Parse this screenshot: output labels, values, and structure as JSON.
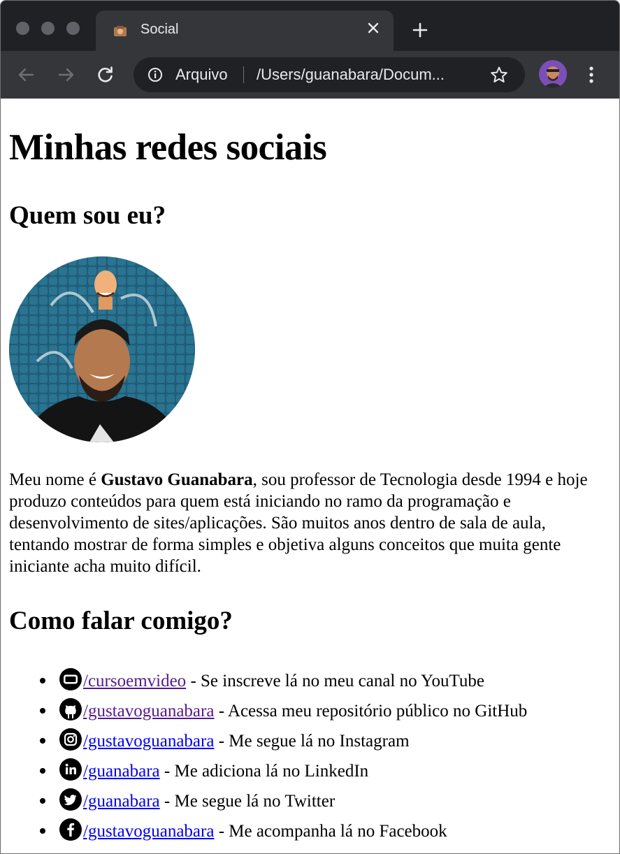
{
  "browser": {
    "tab_title": "Social",
    "site_label": "Arquivo",
    "url": "/Users/guanabara/Docum..."
  },
  "page": {
    "heading": "Minhas redes sociais",
    "section_about": "Quem sou eu?",
    "bio": {
      "before": "Meu nome é ",
      "name": "Gustavo Guanabara",
      "after": ", sou professor de Tecnologia desde 1994 e hoje produzo conteúdos para quem está iniciando no ramo da programação e desenvolvimento de sites/aplicações. São muitos anos dentro de sala de aula, tentando mostrar de forma simples e objetiva alguns conceitos que muita gente iniciante acha muito difícil."
    },
    "section_contact": "Como falar comigo?",
    "social": [
      {
        "icon": "youtube-icon",
        "link": "/cursoemvideo",
        "desc": " - Se inscreve lá no meu canal no YouTube"
      },
      {
        "icon": "github-icon",
        "link": "/gustavoguanabara",
        "desc": " - Acessa meu repositório público no GitHub"
      },
      {
        "icon": "instagram-icon",
        "link": "/gustavoguanabara",
        "desc": " - Me segue lá no Instagram"
      },
      {
        "icon": "linkedin-icon",
        "link": "/guanabara",
        "desc": " - Me adiciona lá no LinkedIn"
      },
      {
        "icon": "twitter-icon",
        "link": "/guanabara",
        "desc": " - Me segue lá no Twitter"
      },
      {
        "icon": "facebook-icon",
        "link": "/gustavoguanabara",
        "desc": " - Me acompanha lá no Facebook"
      }
    ]
  },
  "colors": {
    "tabbar": "#202124",
    "toolbar": "#35363a",
    "link": "#0000ee",
    "visited_link": "#551a8b"
  }
}
